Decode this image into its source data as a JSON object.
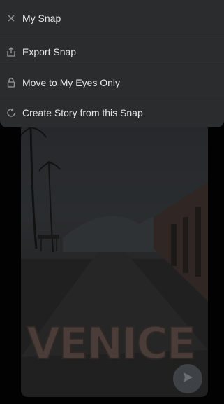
{
  "menu": {
    "title": "My Snap",
    "items": [
      {
        "label": "Export Snap",
        "icon": "export-icon"
      },
      {
        "label": "Move to My Eyes Only",
        "icon": "lock-icon"
      },
      {
        "label": "Create Story from this Snap",
        "icon": "story-icon"
      }
    ]
  },
  "snap": {
    "sticker_text": "VENICE"
  },
  "icons": {
    "close": "close-icon",
    "delete": "trash-icon",
    "edit": "pencil-icon",
    "send": "send-arrow-icon"
  },
  "colors": {
    "sheet_bg": "#2b2c2e",
    "text": "#e6e6e6",
    "icon": "#9a9a9a"
  }
}
